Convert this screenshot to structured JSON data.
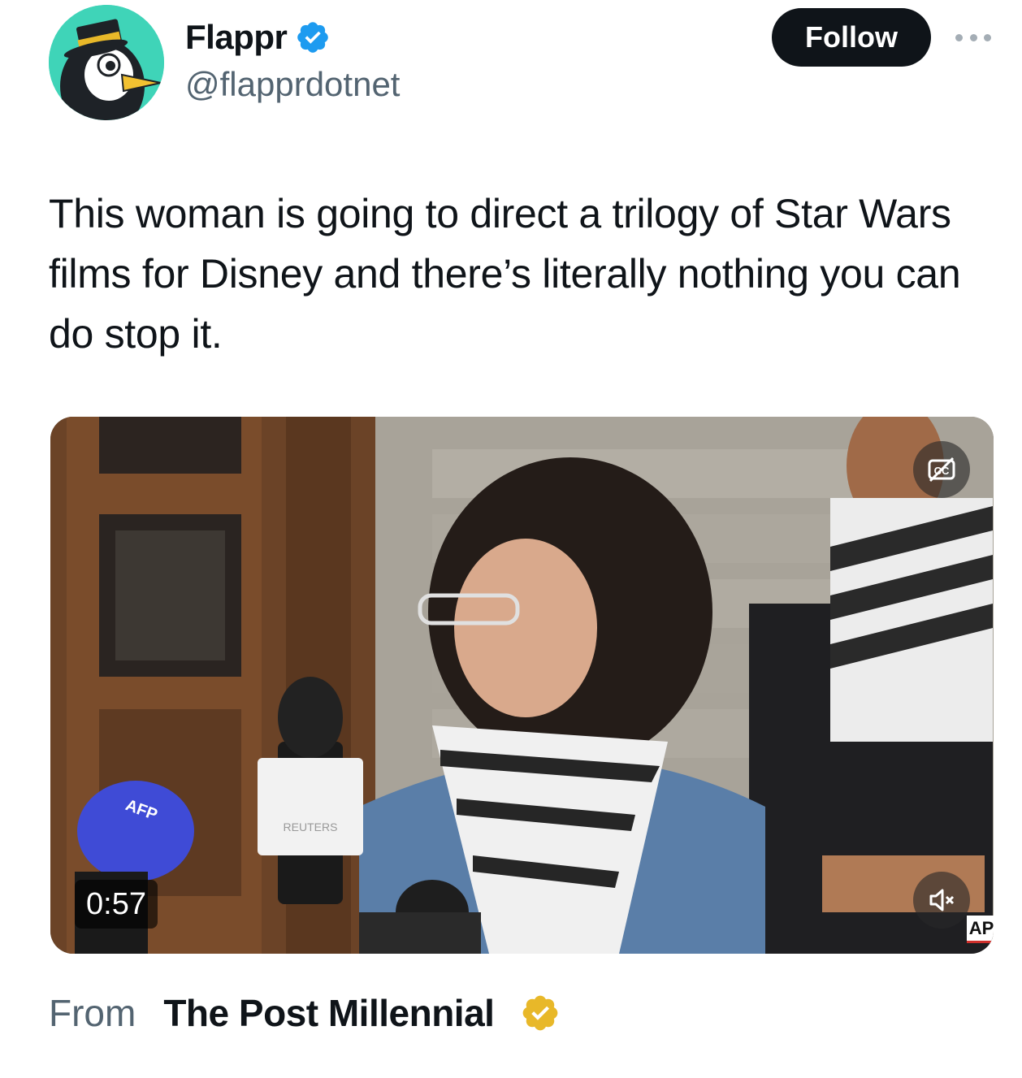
{
  "author": {
    "display_name": "Flappr",
    "handle": "@flapprdotnet",
    "avatar_icon": "penguin-with-top-hat",
    "verified_badge": "blue-verified",
    "verified_color": "#1d9bf0"
  },
  "actions": {
    "follow_label": "Follow",
    "more_icon": "more-dots"
  },
  "tweet": {
    "text": "This woman is going to direct a trilogy of Star Wars films for Disney and there’s literally nothing you can do stop it."
  },
  "video": {
    "duration": "0:57",
    "captions_icon": "captions-off",
    "mute_icon": "volume-muted",
    "watermark": "AP",
    "mic_labels": {
      "afp": "AFP",
      "reuters": "REUTERS"
    }
  },
  "attribution": {
    "prefix": "From",
    "source_name": "The Post Millennial",
    "verified_badge": "gold-verified",
    "verified_color": "#e8b829"
  },
  "colors": {
    "text_primary": "#0f1419",
    "text_secondary": "#536471",
    "follow_bg": "#0f1419",
    "avatar_bg": "#3fd4b8"
  }
}
